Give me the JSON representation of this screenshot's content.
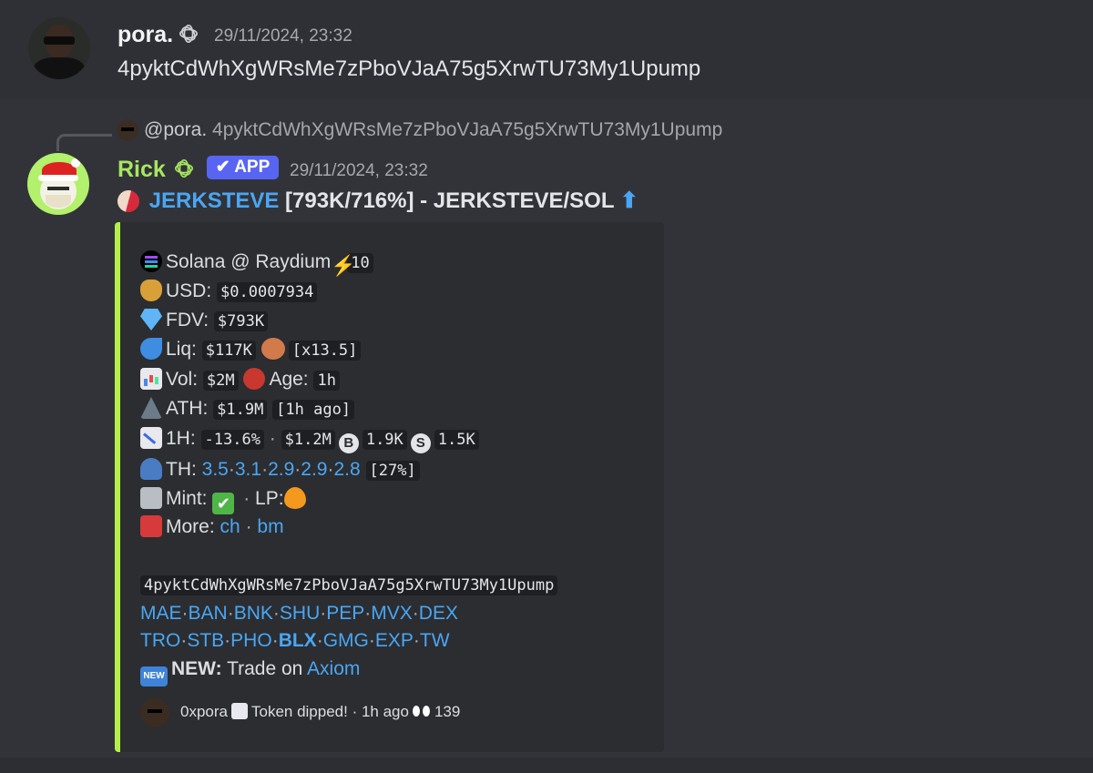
{
  "message1": {
    "author": "pora.",
    "timestamp": "29/11/2024, 23:32",
    "content": "4pyktCdWhXgWRsMe7zPboVJaA75g5XrwTU73My1Upump"
  },
  "reply": {
    "mention": "@pora.",
    "text": "4pyktCdWhXgWRsMe7zPboVJaA75g5XrwTU73My1Upump"
  },
  "message2": {
    "author": "Rick",
    "author_color": "#a7e660",
    "app_badge": "✔ APP",
    "timestamp": "29/11/2024, 23:32",
    "title_token": "JERKSTEVE",
    "title_rest": " [793K/716%] - JERKSTEVE/SOL ",
    "title_arrow": "⬆"
  },
  "embed": {
    "accent": "#b5ef4a",
    "chain": "Solana @ Raydium",
    "chain_num": "10",
    "usd_label": "USD:",
    "usd_value": "$0.0007934",
    "fdv_label": "FDV:",
    "fdv_value": "$793K",
    "liq_label": "Liq:",
    "liq_value": "$117K",
    "liq_mult": "[x13.5]",
    "vol_label": "Vol:",
    "vol_value": "$2M",
    "age_label": "Age:",
    "age_value": "1h",
    "ath_label": "ATH:",
    "ath_value": "$1.9M",
    "ath_ago": "[1h ago]",
    "h1_label": "1H:",
    "h1_change": "-13.6%",
    "h1_vol": "$1.2M",
    "buy_icon": "B",
    "buy_value": "1.9K",
    "sell_icon": "S",
    "sell_value": "1.5K",
    "th_label": "TH:",
    "th_values": [
      "3.5",
      "3.1",
      "2.9",
      "2.9",
      "2.8"
    ],
    "th_total": "[27%]",
    "mint_label": "Mint:",
    "lp_label": "LP:",
    "more_label": "More:",
    "more_links": [
      "ch",
      "bm"
    ],
    "address": "4pyktCdWhXgWRsMe7zPboVJaA75g5XrwTU73My1Upump",
    "links_row1": [
      "MAE",
      "BAN",
      "BNK",
      "SHU",
      "PEP",
      "MVX",
      "DEX"
    ],
    "links_row2": [
      "TRO",
      "STB",
      "PHO",
      "BLX",
      "GMG",
      "EXP",
      "TW"
    ],
    "new_badge": "NEW",
    "new_label": "NEW:",
    "new_text": "Trade on ",
    "new_link": "Axiom",
    "footer_user": "0xpora",
    "footer_text": "Token dipped! · 1h ago",
    "footer_count": "139"
  }
}
